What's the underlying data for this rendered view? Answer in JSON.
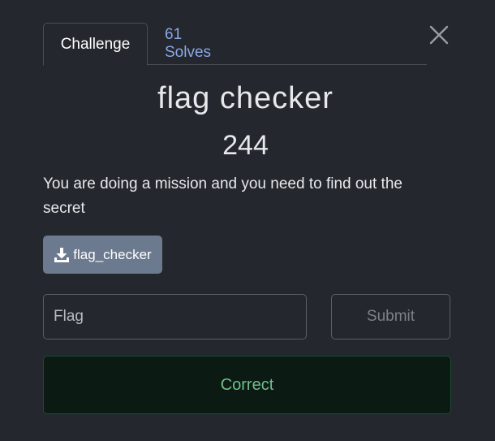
{
  "tabs": [
    {
      "label": "Challenge"
    },
    {
      "label": "61 Solves"
    }
  ],
  "challenge": {
    "title": "flag checker",
    "points": "244",
    "description": "You are doing a mission and you need to find out the secret",
    "file_label": "flag_checker"
  },
  "form": {
    "flag_placeholder": "Flag",
    "submit_label": "Submit"
  },
  "result": {
    "message": "Correct"
  },
  "icons": {
    "close": "close-icon",
    "download": "download-icon"
  },
  "colors": {
    "background": "#24272d",
    "solves_link": "#8aa7e6",
    "file_button": "#6c7a8f",
    "success_bg": "#0c1a14",
    "success_text": "#6fbf8a"
  }
}
